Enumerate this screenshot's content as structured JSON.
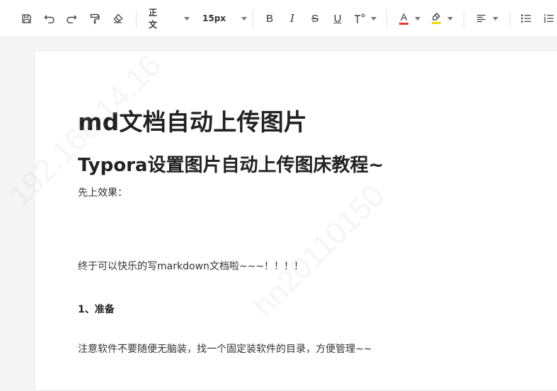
{
  "toolbar": {
    "paragraph_style": "正文",
    "font_size": "15px",
    "bold_label": "B",
    "italic_label": "I",
    "strike_label": "S",
    "underline_label": "U",
    "font_color_label": "A",
    "font_color": "#e53935",
    "highlight_color": "#f5d90a"
  },
  "document": {
    "title": "md文档自动上传图片",
    "subtitle": "Typora设置图片自动上传图床教程~",
    "intro": "先上效果：",
    "paragraph_1": "终于可以快乐的写markdown文档啦~~~！！！！",
    "section_1_heading": "1、准备",
    "paragraph_2": "注意软件不要随便无脑装，找一个固定装软件的目录，方便管理~~"
  },
  "watermark": {
    "text_1": "192.168.14.16",
    "text_2": "hn20110150"
  }
}
